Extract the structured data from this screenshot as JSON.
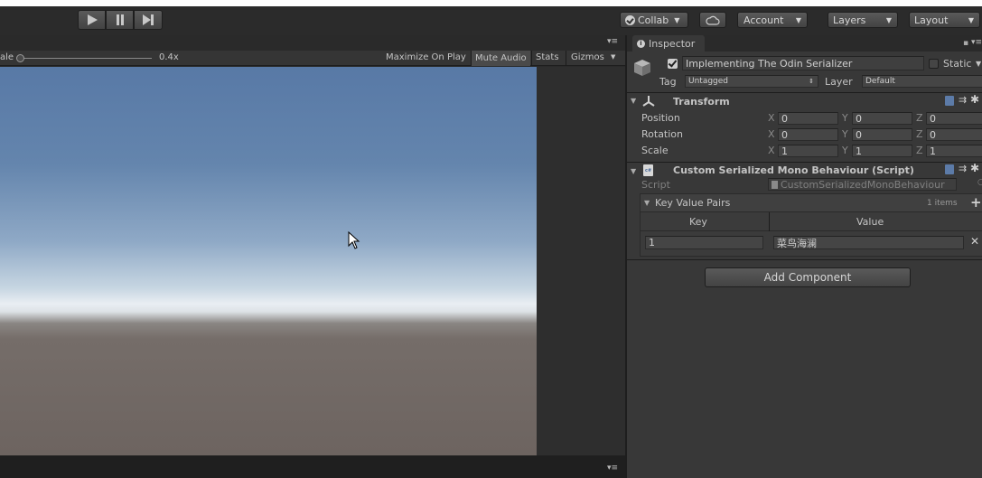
{
  "toolbar": {
    "play_icon": "play-icon",
    "pause_icon": "pause-icon",
    "step_icon": "step-icon",
    "collab_label": "Collab",
    "account_label": "Account",
    "layers_label": "Layers",
    "layout_label": "Layout"
  },
  "game_view": {
    "scale_label": "ale",
    "scale_value": "0.4x",
    "maximize_on_play": "Maximize On Play",
    "mute_audio": "Mute Audio",
    "stats": "Stats",
    "gizmos": "Gizmos"
  },
  "inspector": {
    "tab_label": "Inspector",
    "object_name": "Implementing The Odin Serializer",
    "static_label": "Static",
    "tag_label": "Tag",
    "tag_value": "Untagged",
    "layer_label": "Layer",
    "layer_value": "Default",
    "transform": {
      "title": "Transform",
      "rows": [
        {
          "label": "Position",
          "x": "0",
          "y": "0",
          "z": "0"
        },
        {
          "label": "Rotation",
          "x": "0",
          "y": "0",
          "z": "0"
        },
        {
          "label": "Scale",
          "x": "1",
          "y": "1",
          "z": "1"
        }
      ],
      "axis_x": "X",
      "axis_y": "Y",
      "axis_z": "Z"
    },
    "script_component": {
      "title": "Custom Serialized Mono Behaviour (Script)",
      "script_label": "Script",
      "script_value": "CustomSerializedMonoBehaviour",
      "dict_title": "Key Value Pairs",
      "dict_count": "1 items",
      "col_key": "Key",
      "col_value": "Value",
      "entries": [
        {
          "key": "1",
          "value": "菜鸟海澜"
        }
      ]
    },
    "add_component": "Add Component"
  },
  "colors": {
    "bg_dark": "#2a2a2a",
    "panel": "#383838",
    "sky_top": "#5b7aa6",
    "horizon": "#e8eef4",
    "ground": "#6f6561"
  }
}
